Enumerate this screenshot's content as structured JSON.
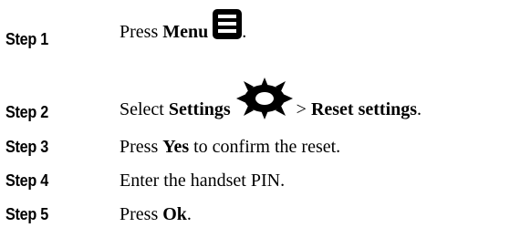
{
  "steps": [
    {
      "label": "Step 1",
      "text_before": "Press ",
      "bold1": "Menu",
      "text_after": "."
    },
    {
      "label": "Step 2",
      "text_before": "Select ",
      "bold1": "Settings",
      "separator": "> ",
      "bold2": "Reset settings",
      "text_after": "."
    },
    {
      "label": "Step 3",
      "text_before": "Press ",
      "bold1": "Yes",
      "text_after": " to confirm the reset."
    },
    {
      "label": "Step 4",
      "text": "Enter the handset PIN."
    },
    {
      "label": "Step 5",
      "text_before": "Press ",
      "bold1": "Ok",
      "text_after": "."
    }
  ],
  "icons": {
    "menu": "menu-icon",
    "settings": "gear-icon"
  }
}
